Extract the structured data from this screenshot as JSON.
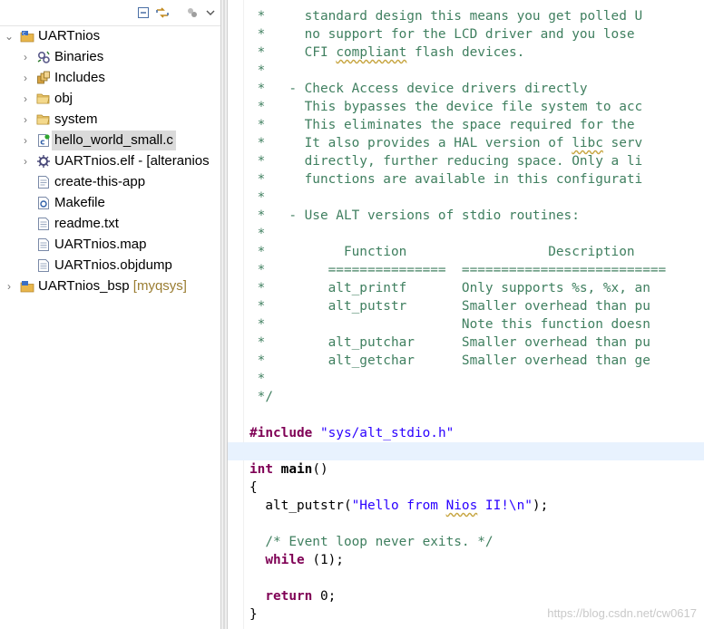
{
  "explorer": {
    "toolbar": {
      "collapse_all_icon": "collapse-all-icon",
      "link_editor_icon": "link-with-editor-icon",
      "filters_icon": "filters-icon",
      "view_menu_icon": "view-menu-icon"
    },
    "tree": [
      {
        "label": "UARTnios",
        "decoration": "",
        "icon": "nios-project-icon",
        "depth": 0,
        "expanded": true
      },
      {
        "label": "Binaries",
        "decoration": "",
        "icon": "binaries-icon",
        "depth": 1,
        "expanded": false
      },
      {
        "label": "Includes",
        "decoration": "",
        "icon": "includes-icon",
        "depth": 1,
        "expanded": false
      },
      {
        "label": "obj",
        "decoration": "",
        "icon": "folder-icon",
        "depth": 1,
        "expanded": false
      },
      {
        "label": "system",
        "decoration": "",
        "icon": "folder-icon",
        "depth": 1,
        "expanded": false
      },
      {
        "label": "hello_world_small.c",
        "decoration": "",
        "icon": "c-source-file-icon",
        "depth": 1,
        "expanded": false,
        "selected": true
      },
      {
        "label": "UARTnios.elf - [alteranios",
        "decoration": "",
        "icon": "elf-binary-icon",
        "depth": 1,
        "expanded": false
      },
      {
        "label": "create-this-app",
        "decoration": "",
        "icon": "file-icon",
        "depth": 1,
        "leaf": true
      },
      {
        "label": "Makefile",
        "decoration": "",
        "icon": "makefile-icon",
        "depth": 1,
        "leaf": true
      },
      {
        "label": "readme.txt",
        "decoration": "",
        "icon": "text-file-icon",
        "depth": 1,
        "leaf": true
      },
      {
        "label": "UARTnios.map",
        "decoration": "",
        "icon": "text-file-icon",
        "depth": 1,
        "leaf": true
      },
      {
        "label": "UARTnios.objdump",
        "decoration": "",
        "icon": "text-file-icon",
        "depth": 1,
        "leaf": true
      },
      {
        "label": "UARTnios_bsp",
        "decoration": "[myqsys]",
        "icon": "nios-bsp-project-icon",
        "depth": 0,
        "expanded": false
      }
    ]
  },
  "editor": {
    "lines": [
      [
        {
          "t": " *     standard design this means you get polled U",
          "c": "cm"
        }
      ],
      [
        {
          "t": " *     no support for the LCD driver and you lose",
          "c": "cm"
        }
      ],
      [
        {
          "t": " *     ",
          "c": "cm"
        },
        {
          "t": "CFI",
          "c": "cm"
        },
        {
          "t": " ",
          "c": "cm"
        },
        {
          "t": "compliant",
          "c": "cm sp"
        },
        {
          "t": " flash devices.",
          "c": "cm"
        }
      ],
      [
        {
          "t": " *",
          "c": "cm"
        }
      ],
      [
        {
          "t": " *   - Check Access device drivers directly",
          "c": "cm"
        }
      ],
      [
        {
          "t": " *     This bypasses the device file system to acc",
          "c": "cm"
        }
      ],
      [
        {
          "t": " *     This eliminates the space required for the",
          "c": "cm"
        }
      ],
      [
        {
          "t": " *     It also provides a HAL version of ",
          "c": "cm"
        },
        {
          "t": "libc",
          "c": "cm sp"
        },
        {
          "t": " serv",
          "c": "cm"
        }
      ],
      [
        {
          "t": " *     directly, further reducing space. Only a li",
          "c": "cm"
        }
      ],
      [
        {
          "t": " *     functions are available in this configurati",
          "c": "cm"
        }
      ],
      [
        {
          "t": " *",
          "c": "cm"
        }
      ],
      [
        {
          "t": " *   - Use ALT versions of stdio routines:",
          "c": "cm"
        }
      ],
      [
        {
          "t": " *",
          "c": "cm"
        }
      ],
      [
        {
          "t": " *          Function                  Description",
          "c": "cm"
        }
      ],
      [
        {
          "t": " *        ===============  ==========================",
          "c": "cm"
        }
      ],
      [
        {
          "t": " *        alt_printf       Only supports %s, %x, an",
          "c": "cm"
        }
      ],
      [
        {
          "t": " *        alt_putstr       Smaller overhead than pu",
          "c": "cm"
        }
      ],
      [
        {
          "t": " *                         Note this function doesn",
          "c": "cm"
        }
      ],
      [
        {
          "t": " *        alt_putchar      Smaller overhead than pu",
          "c": "cm"
        }
      ],
      [
        {
          "t": " *        alt_getchar      Smaller overhead than ge",
          "c": "cm"
        }
      ],
      [
        {
          "t": " *",
          "c": "cm"
        }
      ],
      [
        {
          "t": " */",
          "c": "cm"
        }
      ],
      [
        {
          "t": "",
          "c": "tx"
        }
      ],
      [
        {
          "t": "#include",
          "c": "pp"
        },
        {
          "t": " ",
          "c": "tx"
        },
        {
          "t": "\"sys/alt_stdio.h\"",
          "c": "str"
        }
      ],
      [
        {
          "t": "",
          "c": "tx",
          "hl": true
        }
      ],
      [
        {
          "t": "int",
          "c": "kw"
        },
        {
          "t": " ",
          "c": "tx"
        },
        {
          "t": "main",
          "c": "fn"
        },
        {
          "t": "()",
          "c": "tx"
        }
      ],
      [
        {
          "t": "{",
          "c": "tx"
        }
      ],
      [
        {
          "t": "  alt_putstr(",
          "c": "tx"
        },
        {
          "t": "\"Hello from ",
          "c": "str"
        },
        {
          "t": "Nios",
          "c": "str sp"
        },
        {
          "t": " II!\\n\"",
          "c": "str"
        },
        {
          "t": ");",
          "c": "tx"
        }
      ],
      [
        {
          "t": "",
          "c": "tx"
        }
      ],
      [
        {
          "t": "  ",
          "c": "tx"
        },
        {
          "t": "/* Event loop never exits. */",
          "c": "cm"
        }
      ],
      [
        {
          "t": "  ",
          "c": "tx"
        },
        {
          "t": "while",
          "c": "kw"
        },
        {
          "t": " (1);",
          "c": "tx"
        }
      ],
      [
        {
          "t": "",
          "c": "tx"
        }
      ],
      [
        {
          "t": "  ",
          "c": "tx"
        },
        {
          "t": "return",
          "c": "kw"
        },
        {
          "t": " 0;",
          "c": "tx"
        }
      ],
      [
        {
          "t": "}",
          "c": "tx"
        }
      ]
    ],
    "highlight_line_index": 24
  },
  "watermark": "https://blog.csdn.net/cw0617",
  "colors": {
    "comment": "#3f7f5f",
    "keyword": "#7f0055",
    "string": "#2a00ff",
    "current_line": "#e8f2fe",
    "selection": "#dadada",
    "decoration": "#9a7d32"
  }
}
